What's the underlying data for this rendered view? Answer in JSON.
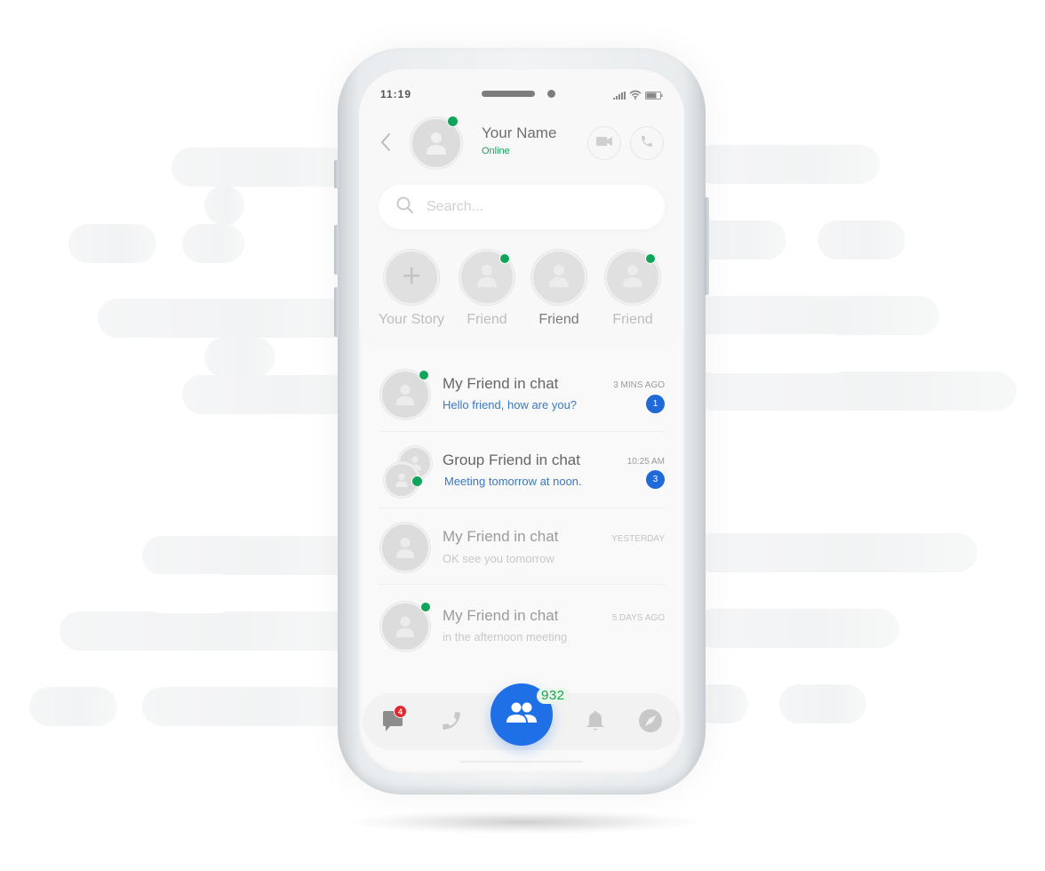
{
  "status_bar": {
    "time": "11:19",
    "icons": [
      "signal-icon",
      "wifi-icon",
      "battery-icon"
    ]
  },
  "header": {
    "back_icon": "chevron-left-icon",
    "name": "Your Name",
    "status": "Online",
    "actions": [
      {
        "name": "video-call",
        "icon": "video-camera-icon"
      },
      {
        "name": "voice-call",
        "icon": "phone-icon"
      }
    ]
  },
  "search": {
    "placeholder": "Search...",
    "value": "",
    "icon": "search-icon"
  },
  "stories": [
    {
      "label": "Your Story",
      "type": "add",
      "online": false,
      "active": false
    },
    {
      "label": "Friend",
      "type": "friend",
      "online": true,
      "active": false
    },
    {
      "label": "Friend",
      "type": "friend",
      "online": false,
      "active": true
    },
    {
      "label": "Friend",
      "type": "friend",
      "online": true,
      "active": false
    }
  ],
  "chats": [
    {
      "name": "My Friend in chat",
      "message": "Hello friend, how are you?",
      "time": "3 MINS AGO",
      "unread": "1",
      "online": true,
      "group": false
    },
    {
      "name": "Group Friend in chat",
      "message": "Meeting tomorrow at noon.",
      "time": "10:25 AM",
      "unread": "3",
      "online": true,
      "group": true
    },
    {
      "name": "My Friend in chat",
      "message": "OK see you tomorrow",
      "time": "YESTERDAY",
      "unread": null,
      "online": false,
      "group": false
    },
    {
      "name": "My Friend in chat",
      "message": "in the afternoon meeting",
      "time": "5 DAYS AGO",
      "unread": null,
      "online": true,
      "group": false
    }
  ],
  "bottom_nav": {
    "items": [
      {
        "name": "messages",
        "icon": "chat-bubble-icon",
        "badge": "4"
      },
      {
        "name": "calls",
        "icon": "phone-icon",
        "badge": null
      },
      {
        "name": "contacts",
        "icon": "users-icon",
        "count": "932"
      },
      {
        "name": "notifications",
        "icon": "bell-icon",
        "badge": null
      },
      {
        "name": "discover",
        "icon": "compass-icon",
        "badge": null
      }
    ]
  },
  "colors": {
    "accent": "#1f6fe6",
    "online": "#10a55a",
    "unread_badge": "#2069d8",
    "notification_badge": "#e0292f",
    "message_preview": "#3c78c2"
  }
}
